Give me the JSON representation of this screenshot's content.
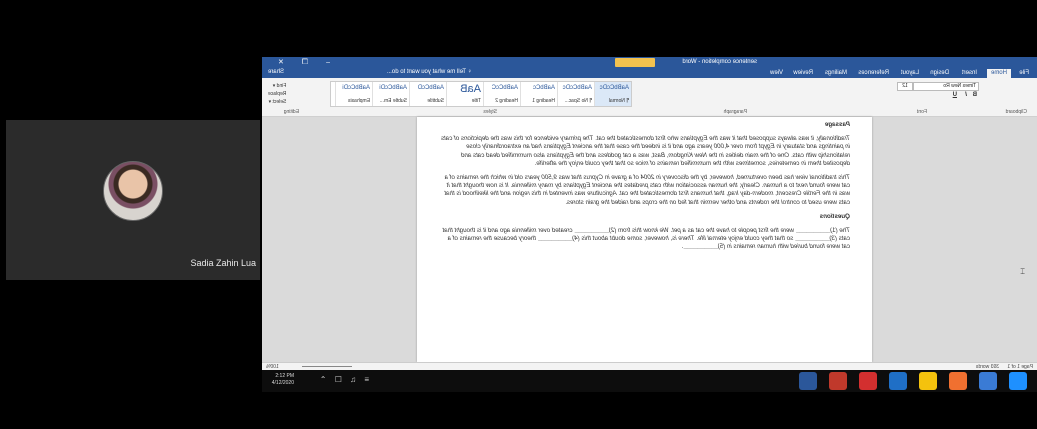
{
  "participant": {
    "name": "Sadia Zahin Lua"
  },
  "window": {
    "title": "sentence completion  -  Word",
    "controls": "–  ❐  ✕"
  },
  "tabs": [
    "File",
    "Home",
    "Insert",
    "Design",
    "Layout",
    "References",
    "Mailings",
    "Review",
    "View"
  ],
  "tell_me": "♀ Tell me what you want to do...",
  "share": "Share",
  "ribbon": {
    "font": "Times New Ro",
    "size": "12",
    "bold": "B",
    "italic": "I",
    "underline": "U",
    "group_clipboard": "Clipboard",
    "group_font": "Font",
    "group_paragraph": "Paragraph",
    "group_styles": "Styles",
    "group_editing": "Editing",
    "editing_find": "Find ▾",
    "editing_replace": "Replace",
    "editing_select": "Select ▾",
    "styles": [
      {
        "sample": "AaBbCcDc",
        "name": "¶ Normal"
      },
      {
        "sample": "AaBbCcDc",
        "name": "¶ No Spac..."
      },
      {
        "sample": "AaBbCc",
        "name": "Heading 1"
      },
      {
        "sample": "AaBbCcC",
        "name": "Heading 2"
      },
      {
        "sample": "AaB",
        "name": "Title"
      },
      {
        "sample": "AaBbCcD",
        "name": "Subtitle"
      },
      {
        "sample": "AaBbCcDi",
        "name": "Subtle Em..."
      },
      {
        "sample": "AaBbCcDi",
        "name": "Emphasis"
      }
    ]
  },
  "document": {
    "heading": "Passage",
    "p1": "Traditionally, it was always supposed that it was the Egyptians who first domesticated the cat. The primary evidence for this was the depictions of cats in paintings and statuary in Egypt from over 4,000 years ago and it is indeed the case that the ancient Egyptians had an extraordinarily close relationship with cats. One of the main deities in the New Kingdom, Bast, was a cat goddess and the Egyptians also mummified dead cats and deposited them in cemeteries, sometimes with the mummified remains of mice so that they could enjoy the afterlife.",
    "p2": "This traditional view has been overturned, however, by the discovery in 2004 of a grave in Cyprus that was 9,500 years old in which the remains of a cat were found next to a human. Clearly, the human association with cats predates the ancient Egyptians by many millennia. It is now thought that it was in the Fertile Crescent, modern-day Iraq, that humans first domesticated the cat. Agriculture was invented in this region and the likelihood is that cats were used to control the rodents and other vermin that fed on the crops and raided the grain stores.",
    "questions_heading": "Questions",
    "q1": "The (1)__________ were the first people to have the cat as a pet. We know this from (2)__________ created over millennia ago and it is thought that cats (3)__________ so that they could enjoy eternal life. There is, however, some doubt about this (4)__________ theory because the remains of a cat were found buried with human remains in (5)__________."
  },
  "status": {
    "page": "Page 1 of 1",
    "words": "393 words",
    "zoom": "100%"
  },
  "taskbar": {
    "time": "2:12 PM",
    "date": "4/12/2020",
    "tray": "⌃ ☐ ♫ ≡"
  }
}
